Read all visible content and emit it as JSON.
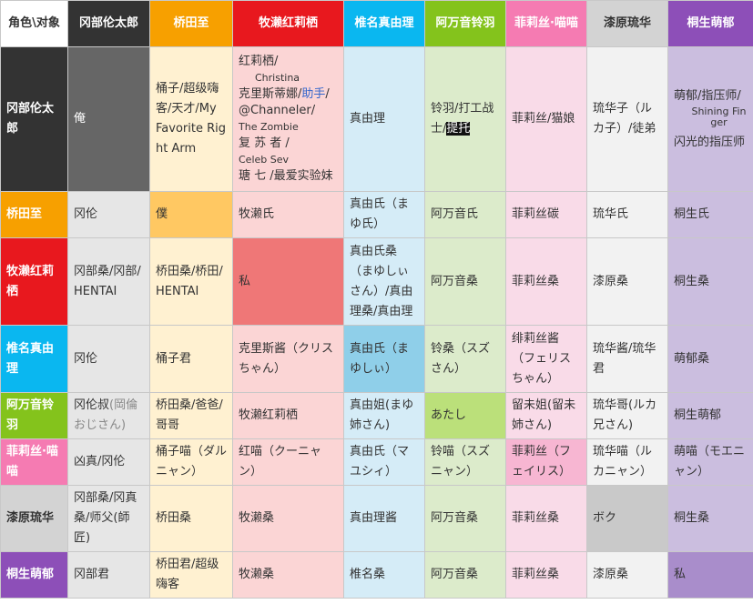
{
  "colors": {
    "okabe": "#333333",
    "okabe_cell": "#666666",
    "itaru": "#f7a000",
    "itaru_col": "#fff1d1",
    "kurisu": "#e8181e",
    "kurisu_col": "#fbd5d5",
    "mayuri": "#0ab7f0",
    "mayuri_col": "#d5ecf7",
    "suzuha": "#84c31c",
    "suzuha_col": "#dcebcb",
    "faris": "#f57bb2",
    "faris_col": "#f9dbe8",
    "ruka": "#d3d3d3",
    "ruka_col": "#f2f2f2",
    "moeka": "#8d4fb8",
    "moeka_col": "#cbbedf"
  },
  "header": [
    "角色\\对象",
    "冈部伦太郎",
    "桥田至",
    "牧濑红莉栖",
    "椎名真由理",
    "阿万音铃羽",
    "菲莉丝·喵喵",
    "漆原琉华",
    "桐生萌郁"
  ],
  "rows": [
    {
      "name": "冈部伦太郎",
      "cells": {
        "c1": "俺",
        "c2": "桶子/超级嗨客/天才/My Favorite Right Arm",
        "c3_a": "红莉栖/",
        "c3_b": "Christina",
        "c3_c": "克里斯蒂娜/",
        "c3_d": "助手",
        "c3_e": "/@Channeler/",
        "c3_f": "The Zombie",
        "c3_g": "复 苏 者 /",
        "c3_h": "Celeb Sev",
        "c3_i": "瑭 七 /最爱实验妹",
        "c4": "真由理",
        "c5_a": "铃羽/打工战士/",
        "c5_b": "提托",
        "c6": "菲莉丝/猫娘",
        "c7": "琉华子（ルカ子）/徒弟",
        "c8_a": "萌郁/指压师/",
        "c8_b": "Shining Finger",
        "c8_c": "闪光的指压师"
      }
    },
    {
      "name": "桥田至",
      "cells": [
        "冈伦",
        "僕",
        "牧濑氏",
        "真由氏（まゆ氏）",
        "阿万音氏",
        "菲莉丝碳",
        "琉华氏",
        "桐生氏"
      ]
    },
    {
      "name": "牧濑红莉栖",
      "cells": [
        "冈部桑/冈部/HENTAI",
        "桥田桑/桥田/HENTAI",
        "私",
        "真由氏桑（まゆしぃさん）/真由理桑/真由理",
        "阿万音桑",
        "菲莉丝桑",
        "漆原桑",
        "桐生桑"
      ]
    },
    {
      "name": "椎名真由理",
      "cells": [
        "冈伦",
        "桶子君",
        "克里斯酱（クリスちゃん）",
        "真由氏（まゆしぃ）",
        "铃桑（スズさん）",
        "绯莉丝酱（フェリスちゃん）",
        "琉华酱/琉华君",
        "萌郁桑"
      ]
    },
    {
      "name": "阿万音铃羽",
      "cells": [
        "冈伦叔",
        "(岡倫おじさん)",
        "桥田桑/爸爸/哥哥",
        "牧濑红莉栖",
        "真由姐(まゆ姉さん)",
        "あたし",
        "留未姐(留未姉さん)",
        "琉华哥(ルカ兄さん)",
        "桐生萌郁"
      ]
    },
    {
      "name": "菲莉丝·喵喵",
      "cells": [
        "凶真/冈伦",
        "桶子喵（ダルニャン）",
        "红喵（クーニャン）",
        "真由氏（マユシィ）",
        "铃喵（スズニャン）",
        "菲莉丝（フェイリス）",
        "琉华喵（ルカニャン）",
        "萌喵（モエニャン）"
      ]
    },
    {
      "name": "漆原琉华",
      "cells": [
        "冈部桑/冈真桑/师父(師匠)",
        "桥田桑",
        "牧濑桑",
        "真由理酱",
        "阿万音桑",
        "菲莉丝桑",
        "ボク",
        "桐生桑"
      ]
    },
    {
      "name": "桐生萌郁",
      "cells": [
        "冈部君",
        "桥田君/超级嗨客",
        "牧濑桑",
        "椎名桑",
        "阿万音桑",
        "菲莉丝桑",
        "漆原桑",
        "私"
      ]
    }
  ]
}
